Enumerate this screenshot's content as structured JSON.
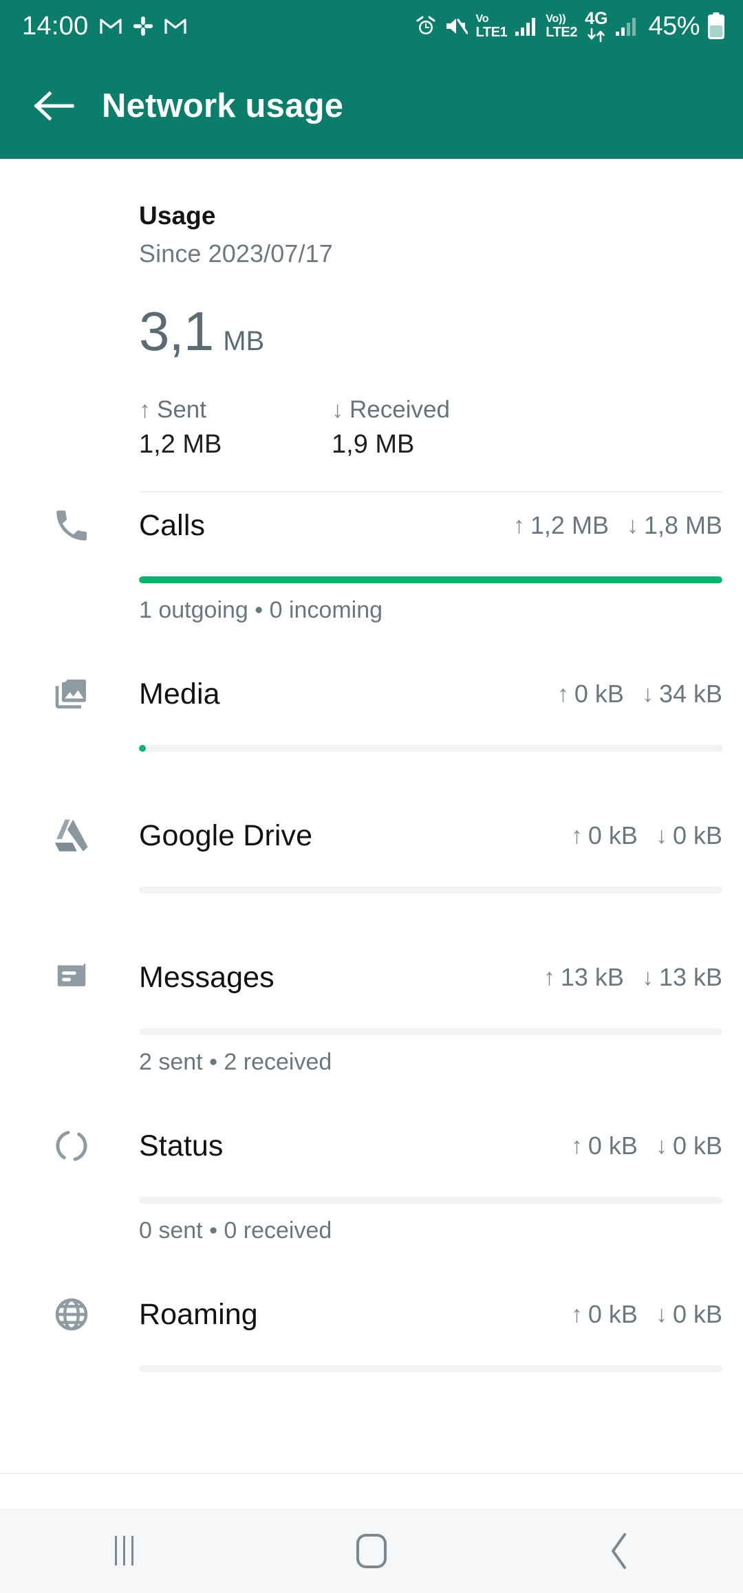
{
  "statusbar": {
    "time": "14:00",
    "left_icons": [
      "gmail-icon",
      "slack-icon",
      "gmail-icon"
    ],
    "right_icons": [
      "alarm-icon",
      "mute-icon",
      "volte1-icon",
      "signal-sim1-icon",
      "volte2-icon",
      "data-transfer-icon",
      "4g-icon",
      "signal-sim2-icon"
    ],
    "volte1_top": "Vo",
    "volte1_bottom": "LTE1",
    "volte2_top": "Vo))",
    "volte2_bottom": "LTE2",
    "network_type": "4G",
    "battery_percent": "45%"
  },
  "appbar": {
    "back_icon": "back-arrow-icon",
    "title": "Network usage",
    "background_color": "#0A7D6B"
  },
  "usage": {
    "heading": "Usage",
    "since": "Since 2023/07/17",
    "total_value": "3,1",
    "total_unit": "MB",
    "sent": {
      "label": "Sent",
      "value": "1,2 MB",
      "arrow": "↑"
    },
    "received": {
      "label": "Received",
      "value": "1,9 MB",
      "arrow": "↓"
    }
  },
  "colors": {
    "accent_bar": "#06B36F",
    "header": "#0A7D6B",
    "track": "#F1F3F4"
  },
  "rows": [
    {
      "icon": "phone-icon",
      "name": "Calls",
      "sent": "1,2 MB",
      "received": "1,8 MB",
      "bar_percent": 100,
      "subtitle": "1 outgoing • 0 incoming"
    },
    {
      "icon": "media-icon",
      "name": "Media",
      "sent": "0 kB",
      "received": "34 kB",
      "bar_percent": 1,
      "subtitle": ""
    },
    {
      "icon": "google-drive-icon",
      "name": "Google Drive",
      "sent": "0 kB",
      "received": "0 kB",
      "bar_percent": 0,
      "subtitle": ""
    },
    {
      "icon": "messages-icon",
      "name": "Messages",
      "sent": "13 kB",
      "received": "13 kB",
      "bar_percent": 0,
      "subtitle": "2 sent • 2 received"
    },
    {
      "icon": "status-ring-icon",
      "name": "Status",
      "sent": "0 kB",
      "received": "0 kB",
      "bar_percent": 0,
      "subtitle": "0 sent • 0 received"
    },
    {
      "icon": "globe-icon",
      "name": "Roaming",
      "sent": "0 kB",
      "received": "0 kB",
      "bar_percent": 0,
      "subtitle": ""
    }
  ],
  "arrows": {
    "up": "↑",
    "down": "↓"
  },
  "navbar": {
    "recents_label": "recents-icon",
    "home_label": "home-icon",
    "back_label": "back-icon"
  }
}
